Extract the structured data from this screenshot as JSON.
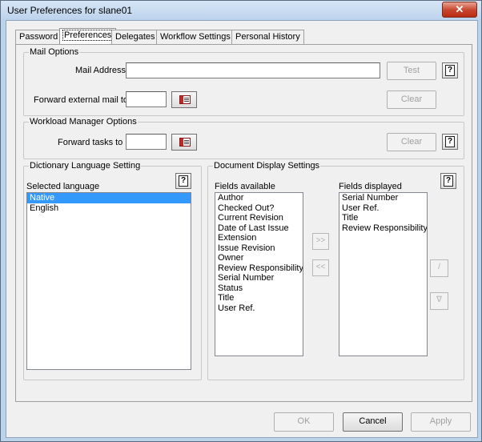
{
  "window": {
    "title": "User Preferences for slane01",
    "close_glyph": "✕"
  },
  "tabs": [
    {
      "label": "Password"
    },
    {
      "label": "Preferences"
    },
    {
      "label": "Delegates"
    },
    {
      "label": "Workflow Settings"
    },
    {
      "label": "Personal History"
    }
  ],
  "mail": {
    "legend": "Mail Options",
    "address_label": "Mail Address",
    "address_value": "",
    "test_button": "Test",
    "forward_label": "Forward external mail to",
    "forward_value": "",
    "clear_button": "Clear"
  },
  "workload": {
    "legend": "Workload Manager Options",
    "forward_label": "Forward tasks to",
    "forward_value": "",
    "clear_button": "Clear"
  },
  "dictionary": {
    "legend": "Dictionary Language Setting",
    "selected_label": "Selected language",
    "languages": [
      "Native",
      "English"
    ],
    "selected_index": 0
  },
  "document": {
    "legend": "Document Display Settings",
    "available_label": "Fields available",
    "available": [
      "Author",
      "Checked Out?",
      "Current Revision",
      "Date of Last Issue",
      "Extension",
      "Issue Revision",
      "Owner",
      "Review Responsibility",
      "Serial Number",
      "Status",
      "Title",
      "User Ref."
    ],
    "displayed_label": "Fields displayed",
    "displayed": [
      "Serial Number",
      "User Ref.",
      "Title",
      "Review Responsibility"
    ],
    "add_glyph": ">>",
    "remove_glyph": "<<",
    "up_glyph": "/",
    "down_glyph": "∇"
  },
  "footer": {
    "ok": "OK",
    "cancel": "Cancel",
    "apply": "Apply"
  },
  "icons": {
    "help": "?",
    "address_book": "address-book-icon"
  },
  "colors": {
    "selection": "#3399ff",
    "window_frame": "#bcd3ec",
    "close_button": "#c7432b"
  }
}
